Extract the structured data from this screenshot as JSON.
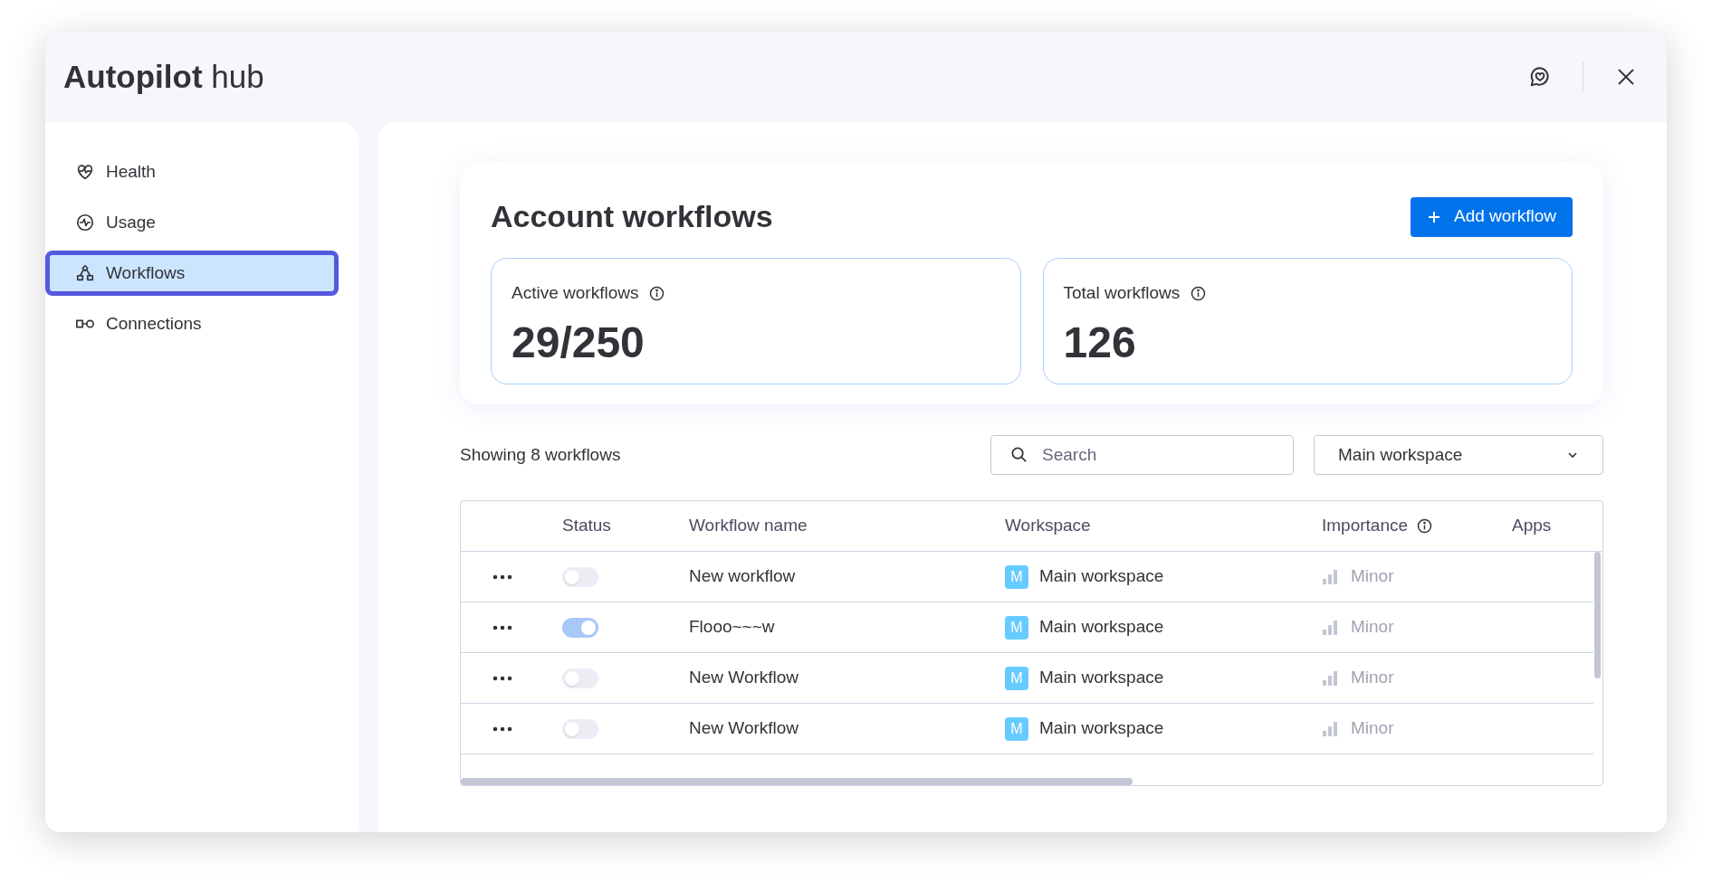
{
  "window": {
    "title_bold": "Autopilot",
    "title_rest": "hub"
  },
  "sidebar": {
    "items": [
      {
        "kind": "health",
        "label": "Health",
        "selected": false
      },
      {
        "kind": "usage",
        "label": "Usage",
        "selected": false
      },
      {
        "kind": "workflows",
        "label": "Workflows",
        "selected": true
      },
      {
        "kind": "connections",
        "label": "Connections",
        "selected": false
      }
    ]
  },
  "summary": {
    "title": "Account workflows",
    "add_button": "Add workflow",
    "stats": [
      {
        "label": "Active workflows",
        "value": "29/250"
      },
      {
        "label": "Total workflows",
        "value": "126"
      }
    ]
  },
  "toolbar": {
    "count_text": "Showing 8 workflows",
    "search": {
      "placeholder": "Search"
    },
    "workspace_select": "Main workspace"
  },
  "table": {
    "columns": [
      {
        "label": "Status"
      },
      {
        "label": "Workflow name"
      },
      {
        "label": "Workspace"
      },
      {
        "label": "Importance",
        "info": true
      },
      {
        "label": "Apps"
      }
    ],
    "rows": [
      {
        "on": false,
        "name": "New workflow",
        "workspace_initial": "M",
        "workspace": "Main workspace",
        "importance": "Minor"
      },
      {
        "on": true,
        "name": "Flooo~~~w",
        "workspace_initial": "M",
        "workspace": "Main workspace",
        "importance": "Minor"
      },
      {
        "on": false,
        "name": "New Workflow",
        "workspace_initial": "M",
        "workspace": "Main workspace",
        "importance": "Minor"
      },
      {
        "on": false,
        "name": "New Workflow",
        "workspace_initial": "M",
        "workspace": "Main workspace",
        "importance": "Minor"
      }
    ]
  }
}
